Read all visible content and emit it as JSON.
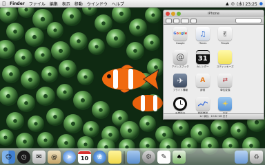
{
  "menubar": {
    "apple_icon": "apple-icon",
    "app_name": "Finder",
    "items": [
      "ファイル",
      "編集",
      "表示",
      "移動",
      "ウインドウ",
      "ヘルプ"
    ],
    "clock": "(水) 23:25"
  },
  "window": {
    "title": "iPhone",
    "status": "12 項目、10.62 GB 空き"
  },
  "apps": [
    {
      "label": "Google",
      "icon": "google-icon"
    },
    {
      "label": "iTunes",
      "icon": "itunes-icon"
    },
    {
      "label": "People",
      "icon": "people-icon"
    },
    {
      "label": "",
      "icon": "blank-icon"
    },
    {
      "label": "アドレスブック",
      "icon": "address-book-icon"
    },
    {
      "label": "カレンダー",
      "icon": "calendar-icon",
      "day": "31"
    },
    {
      "label": "スティッキーズ",
      "icon": "stickies-icon"
    },
    {
      "label": "",
      "icon": "blank-icon"
    },
    {
      "label": "フライト情報",
      "icon": "flight-icon"
    },
    {
      "label": "辞書",
      "icon": "dictionary-icon"
    },
    {
      "label": "単位変換",
      "icon": "unit-converter-icon"
    },
    {
      "label": "",
      "icon": "blank-icon"
    },
    {
      "label": "世界時計",
      "icon": "world-clock-icon"
    },
    {
      "label": "株価情報",
      "icon": "stocks-icon"
    },
    {
      "label": "天気",
      "icon": "weather-icon"
    },
    {
      "label": "",
      "icon": "blank-icon"
    }
  ],
  "dock": [
    "finder-icon",
    "dashboard-icon",
    "mail-icon",
    "address-book-icon",
    "safari-icon",
    "calendar-icon",
    "swirl-icon",
    "stickies-icon",
    "folder-icon",
    "system-preferences-icon",
    "textedit-icon",
    "preview-icon",
    "documents-folder-icon",
    "trash-icon"
  ],
  "calendar_day": "10",
  "colors": {
    "accent": "#3f7fd0",
    "anemone": "#4f8f3f",
    "clownfish": "#f06a10"
  }
}
